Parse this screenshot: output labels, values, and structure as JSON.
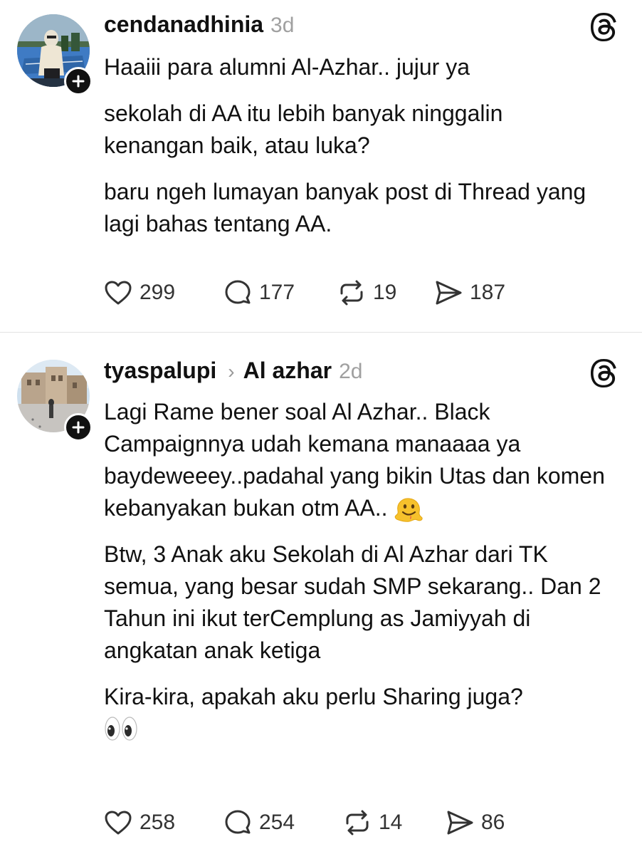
{
  "posts": [
    {
      "username": "cendanadhinia",
      "time": "3d",
      "paragraphs": [
        "Haaiii para alumni Al-Azhar.. jujur ya",
        "sekolah di AA itu lebih banyak ninggalin kenangan baik, atau luka?",
        "baru ngeh lumayan banyak post di Thread yang lagi bahas tentang AA."
      ],
      "likes": "299",
      "comments": "177",
      "reposts": "19",
      "shares": "187"
    },
    {
      "username": "tyaspalupi",
      "topic": "Al azhar",
      "time": "2d",
      "paragraphs": [
        "Lagi Rame bener soal Al Azhar.. Black Campaignnya udah kemana manaaaa ya baydeweeey..padahal yang bikin Utas dan komen kebanyakan bukan otm AA..",
        "Btw, 3 Anak aku Sekolah di Al Azhar dari TK semua, yang besar sudah SMP sekarang.. Dan 2 Tahun ini ikut terCemplung as Jamiyyah di angkatan anak ketiga",
        "Kira-kira, apakah aku perlu Sharing juga?"
      ],
      "emojis": [
        "melting-face-emoji",
        "eyes-emoji"
      ],
      "likes": "258",
      "comments": "254",
      "reposts": "14",
      "shares": "86"
    }
  ],
  "icons": {
    "like": "heart-icon",
    "comment": "comment-bubble-icon",
    "repost": "repost-icon",
    "share": "send-icon",
    "threads": "threads-logo-icon",
    "follow": "plus-icon"
  }
}
